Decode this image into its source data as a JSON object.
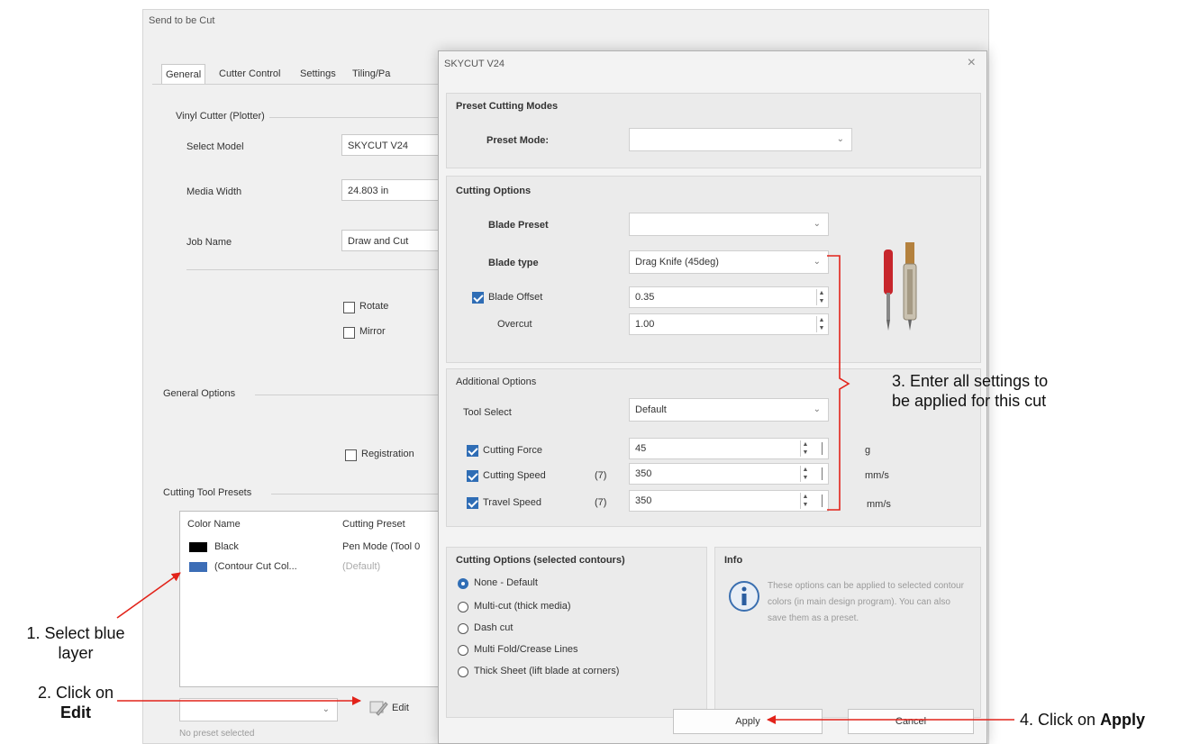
{
  "main_window": {
    "title": "Send to be Cut",
    "tabs": [
      {
        "label": "General",
        "active": true
      },
      {
        "label": "Cutter Control"
      },
      {
        "label": "Settings"
      },
      {
        "label": "Tiling/Pa"
      }
    ],
    "vinyl_cutter": {
      "group_label": "Vinyl Cutter (Plotter)",
      "select_model_label": "Select Model",
      "select_model_value": "SKYCUT V24",
      "media_width_label": "Media Width",
      "media_width_value": "24.803 in",
      "job_name_label": "Job Name",
      "job_name_value": "Draw and Cut",
      "rotate_label": "Rotate",
      "mirror_label": "Mirror"
    },
    "general_options": {
      "group_label": "General Options",
      "registration_label": "Registration"
    },
    "cutting_tool_presets": {
      "group_label": "Cutting Tool Presets",
      "columns": [
        "Color Name",
        "Cutting Preset"
      ],
      "rows": [
        {
          "color": "#000000",
          "name": "Black",
          "preset": "Pen Mode (Tool 0"
        },
        {
          "color": "#3c6db6",
          "name": "(Contour Cut Col...",
          "preset": "(Default)"
        }
      ],
      "edit_label": "Edit",
      "status": "No preset selected"
    }
  },
  "dialog": {
    "title": "SKYCUT V24",
    "preset_cutting_modes": {
      "group_label": "Preset Cutting Modes",
      "preset_mode_label": "Preset Mode:",
      "preset_mode_value": ""
    },
    "cutting_options": {
      "group_label": "Cutting Options",
      "blade_preset_label": "Blade Preset",
      "blade_preset_value": "",
      "blade_type_label": "Blade type",
      "blade_type_value": "Drag Knife (45deg)",
      "blade_offset_label": "Blade Offset",
      "blade_offset_value": "0.35",
      "overcut_label": "Overcut",
      "overcut_value": "1.00"
    },
    "additional_options": {
      "group_label": "Additional Options",
      "tool_select_label": "Tool Select",
      "tool_select_value": "Default",
      "cutting_force_label": "Cutting Force",
      "cutting_force_value": "45",
      "cutting_force_unit": "g",
      "cutting_speed_label": "Cutting Speed",
      "cutting_speed_level": "(7)",
      "cutting_speed_value": "350",
      "cutting_speed_unit": "mm/s",
      "travel_speed_label": "Travel Speed",
      "travel_speed_level": "(7)",
      "travel_speed_value": "350",
      "travel_speed_unit": "mm/s"
    },
    "contour_options": {
      "group_label": "Cutting Options (selected contours)",
      "radios": [
        {
          "label": "None - Default",
          "selected": true
        },
        {
          "label": "Multi-cut (thick media)"
        },
        {
          "label": "Dash cut"
        },
        {
          "label": "Multi Fold/Crease Lines"
        },
        {
          "label": "Thick Sheet (lift blade at corners)"
        }
      ]
    },
    "info": {
      "group_label": "Info",
      "text": "These options can be applied to selected contour colors (in main design program). You can also save them as a preset."
    },
    "apply_label": "Apply",
    "cancel_label": "Cancel"
  },
  "annotations": {
    "step1_line1": "1. Select blue",
    "step1_line2": "layer",
    "step2_line1": "2. Click on",
    "step2_line2": "Edit",
    "step3_line1": "3. Enter all settings to",
    "step3_line2": "be applied for this cut",
    "step4_prefix": "4. Click on",
    "step4_bold": "Apply"
  }
}
